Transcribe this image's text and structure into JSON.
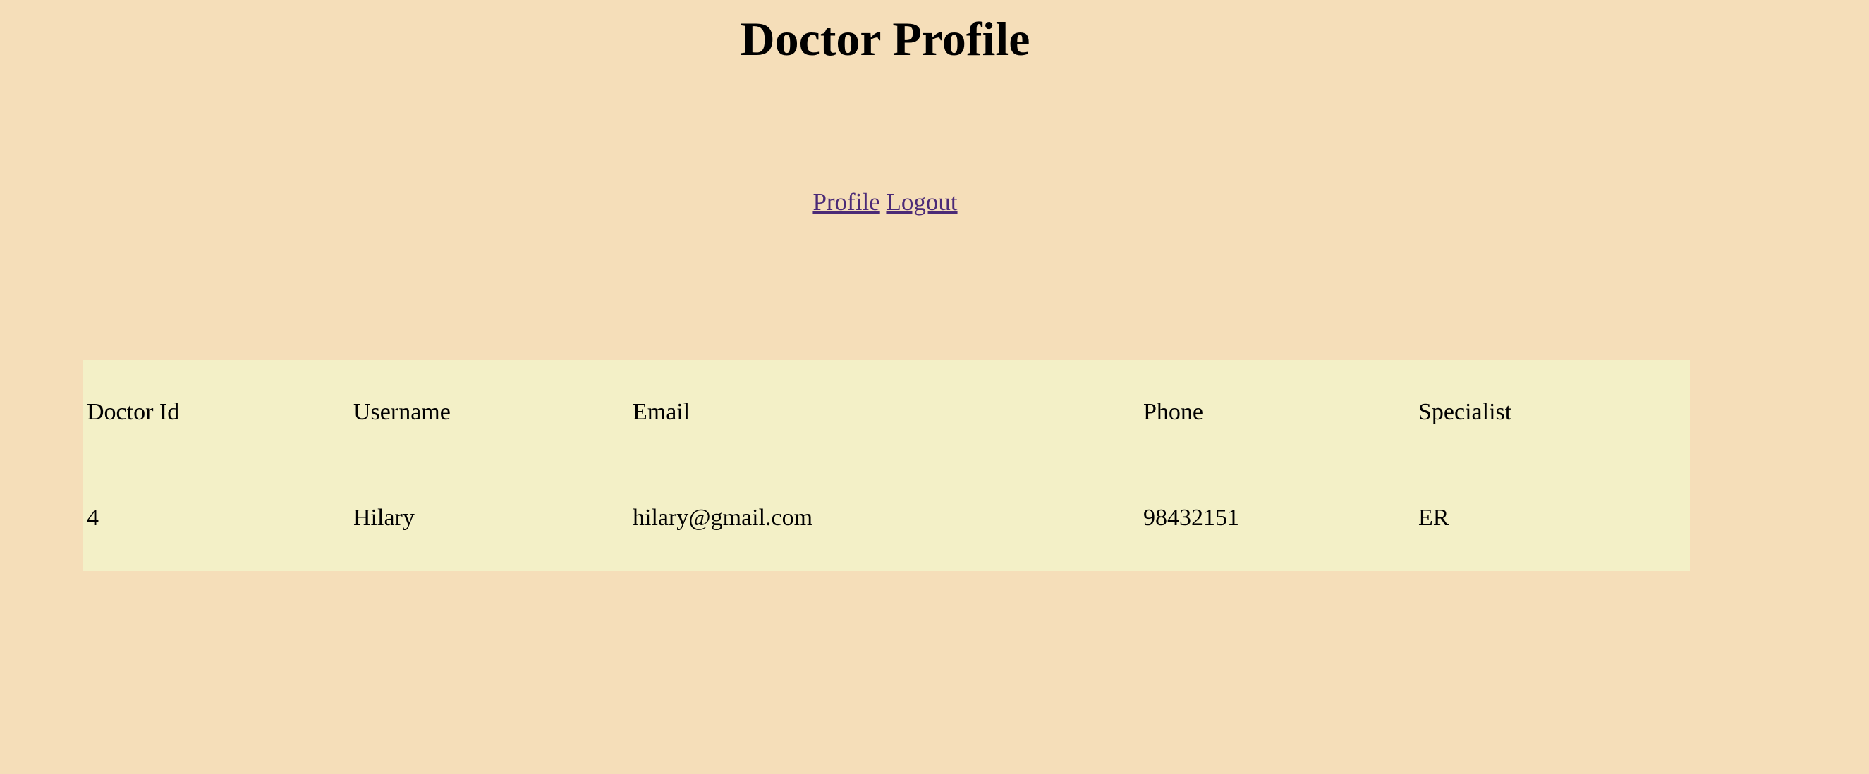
{
  "header": {
    "title": "Doctor Profile"
  },
  "nav": {
    "profile_label": "Profile",
    "logout_label": "Logout"
  },
  "table": {
    "headers": [
      "Doctor Id",
      "Username",
      "Email",
      "Phone",
      "Specialist"
    ],
    "rows": [
      [
        "4",
        "Hilary",
        "hilary@gmail.com",
        "98432151",
        "ER"
      ]
    ]
  },
  "colors": {
    "background": "#f5deb9",
    "table_background": "#f3f0c7",
    "link": "#4b2a77"
  }
}
